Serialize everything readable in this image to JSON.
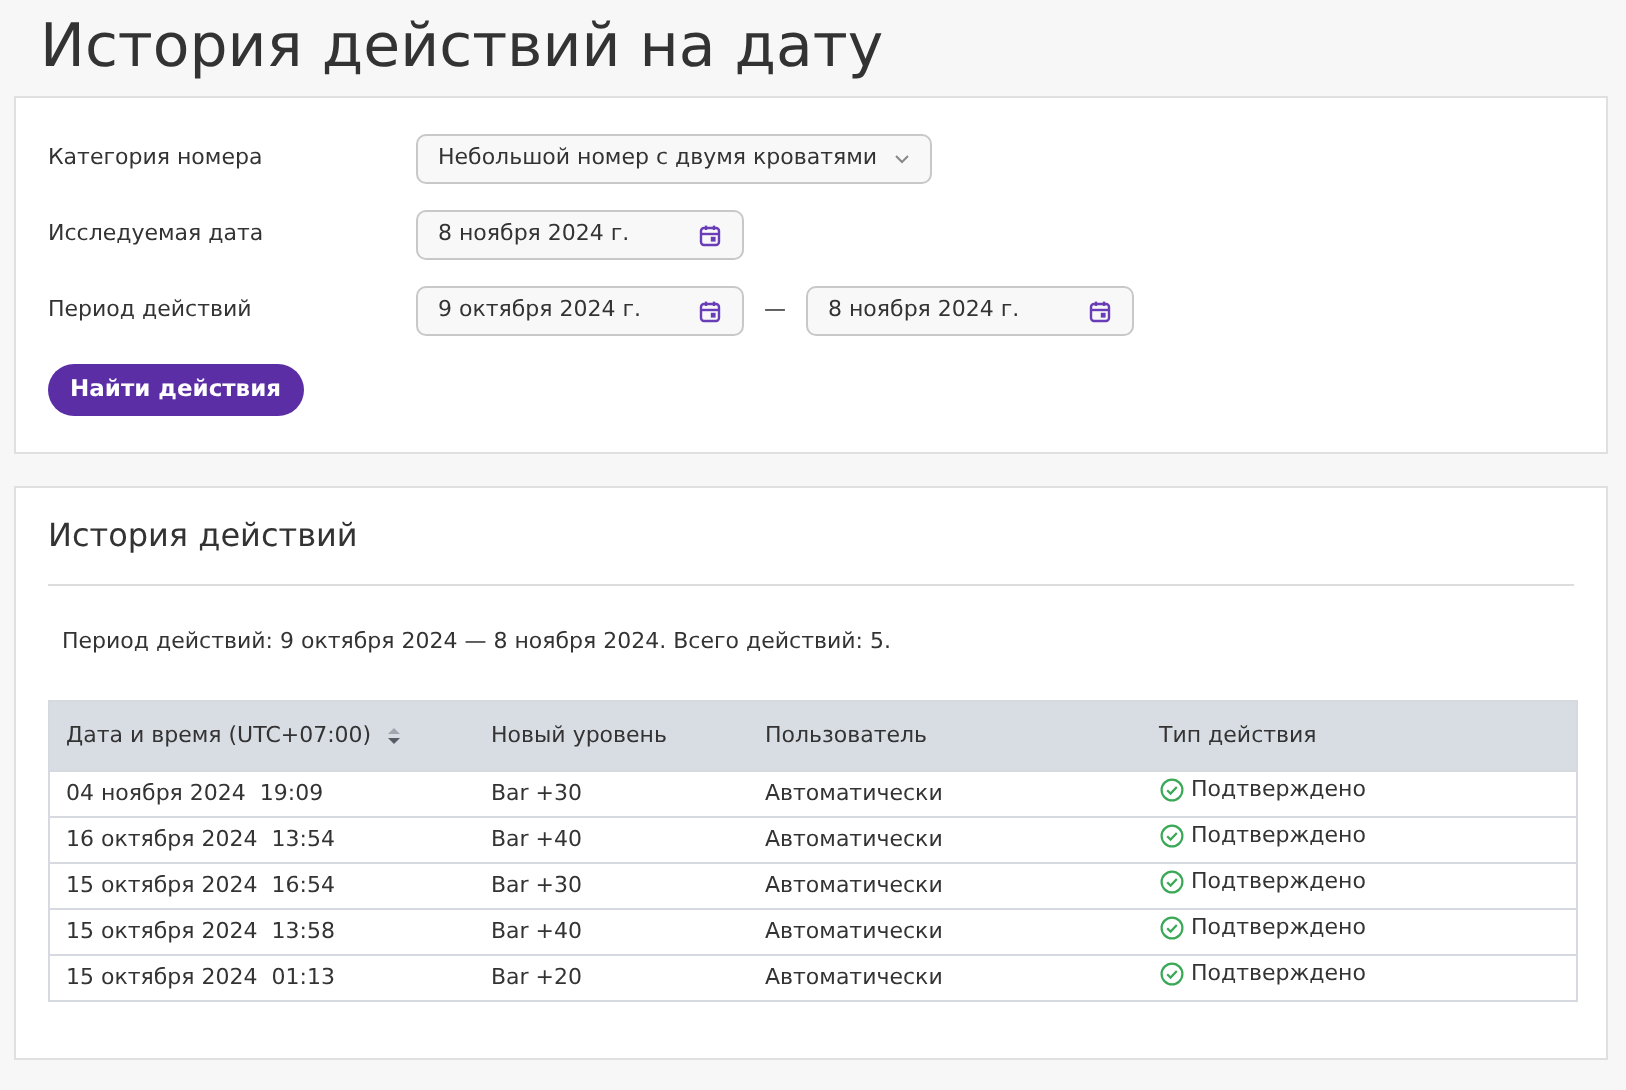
{
  "page_title": "История действий на дату",
  "filters": {
    "fields": [
      {
        "label": "Категория номера",
        "kind": "select",
        "value": "Небольшой номер с двумя кроватями"
      },
      {
        "label": "Исследуемая дата",
        "kind": "date",
        "value": "8 ноября 2024 г."
      },
      {
        "label": "Период действий",
        "kind": "range",
        "value": "9 октября 2024 г.",
        "separator": "—",
        "value_end": "8 ноября 2024 г."
      }
    ],
    "button": "Найти действия"
  },
  "history": {
    "title": "История действий",
    "summary": "Период действий: 9 октября 2024 — 8 ноября 2024. Всего действий: 5.",
    "columns": [
      {
        "label": "Дата и время (UTC+07:00)",
        "sortable": true
      },
      {
        "label": "Новый уровень",
        "sortable": false
      },
      {
        "label": "Пользователь",
        "sortable": false
      },
      {
        "label": "Тип действия",
        "sortable": false
      }
    ],
    "rows": [
      {
        "datetime": "04 ноября 2024  19:09",
        "level": "Bar +30",
        "user": "Автоматически",
        "action": "Подтверждено",
        "kind": "confirmed"
      },
      {
        "datetime": "16 октября 2024  13:54",
        "level": "Bar +40",
        "user": "Автоматически",
        "action": "Подтверждено",
        "kind": "confirmed"
      },
      {
        "datetime": "15 октября 2024  16:54",
        "level": "Bar +30",
        "user": "Автоматически",
        "action": "Подтверждено",
        "kind": "confirmed"
      },
      {
        "datetime": "15 октября 2024  13:58",
        "level": "Bar +40",
        "user": "Автоматически",
        "action": "Подтверждено",
        "kind": "confirmed"
      },
      {
        "datetime": "15 октября 2024  01:13",
        "level": "Bar +20",
        "user": "Автоматически",
        "action": "Подтверждено",
        "kind": "confirmed"
      }
    ]
  }
}
